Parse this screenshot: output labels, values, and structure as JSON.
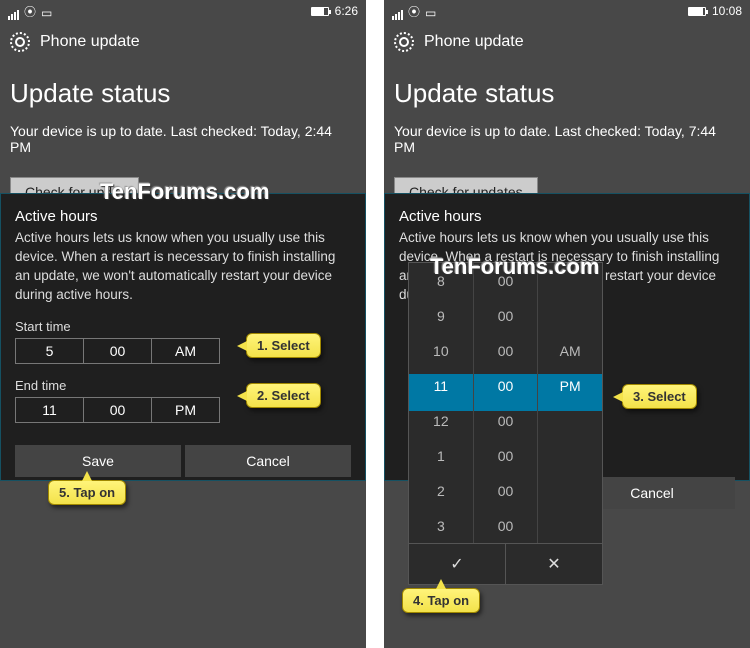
{
  "watermark": "TenForums.com",
  "left": {
    "statusbar_time": "6:26",
    "header_title": "Phone update",
    "status_title": "Update status",
    "status_text": "Your device is up to date. Last checked: Today, 2:44 PM",
    "check_label": "Check for upd...",
    "panel": {
      "title": "Active hours",
      "desc": "Active hours lets us know when you usually use this device. When a restart is necessary to finish installing an update, we won't automatically restart your device during active hours.",
      "start_label": "Start time",
      "start_hour": "5",
      "start_min": "00",
      "start_ampm": "AM",
      "end_label": "End time",
      "end_hour": "11",
      "end_min": "00",
      "end_ampm": "PM",
      "save_label": "Save",
      "cancel_label": "Cancel"
    }
  },
  "right": {
    "statusbar_time": "10:08",
    "header_title": "Phone update",
    "status_title": "Update status",
    "status_text": "Your device is up to date. Last checked: Today, 7:44 PM",
    "check_label": "Check for updates",
    "panel": {
      "title": "Active hours",
      "desc": "Active hours lets us know when you usually use this device. When a restart is necessary to finish installing an update, we won't automatically restart your device during active hours.",
      "cancel_label": "Cancel"
    },
    "picker": {
      "hours": [
        "8",
        "9",
        "10",
        "11",
        "12",
        "1",
        "2",
        "3"
      ],
      "mins": [
        "00",
        "00",
        "00",
        "00",
        "00",
        "00",
        "00",
        "00"
      ],
      "ampm_top": "AM",
      "ampm_sel": "PM",
      "ok": "✓",
      "cancel": "✕"
    }
  },
  "callouts": {
    "c1": "1. Select",
    "c2": "2. Select",
    "c3": "3. Select",
    "c4": "4. Tap on",
    "c5": "5. Tap on"
  }
}
